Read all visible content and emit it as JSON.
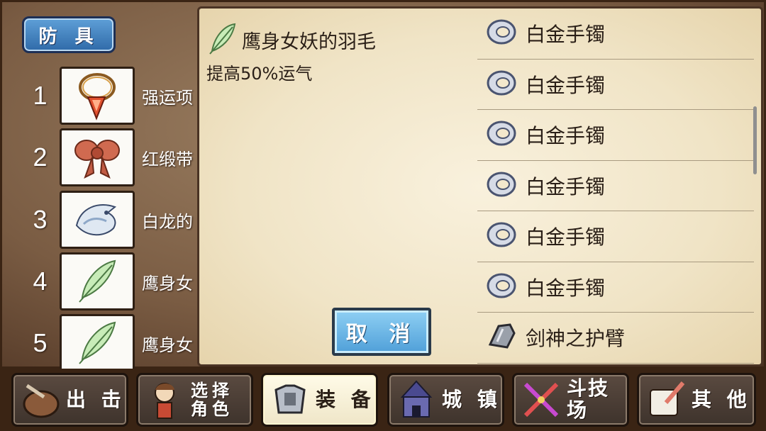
{
  "armor_category": "防 具",
  "armor_slots": [
    {
      "num": "1",
      "name": "强运项",
      "icon": "necklace-icon"
    },
    {
      "num": "2",
      "name": "红缎带",
      "icon": "ribbon-icon"
    },
    {
      "num": "3",
      "name": "白龙的",
      "icon": "white-dragon-icon"
    },
    {
      "num": "4",
      "name": "鹰身女",
      "icon": "feather-icon"
    },
    {
      "num": "5",
      "name": "鹰身女",
      "icon": "feather-icon"
    }
  ],
  "detail": {
    "name": "鹰身女妖的羽毛",
    "description": "提高50%运气",
    "icon": "feather-icon"
  },
  "cancel_label": "取 消",
  "item_list": [
    {
      "name": "白金手镯",
      "icon": "bracelet-icon"
    },
    {
      "name": "白金手镯",
      "icon": "bracelet-icon"
    },
    {
      "name": "白金手镯",
      "icon": "bracelet-icon"
    },
    {
      "name": "白金手镯",
      "icon": "bracelet-icon"
    },
    {
      "name": "白金手镯",
      "icon": "bracelet-icon"
    },
    {
      "name": "白金手镯",
      "icon": "bracelet-icon"
    },
    {
      "name": "剑神之护臂",
      "icon": "gauntlet-icon"
    }
  ],
  "nav": {
    "sortie": "出 击",
    "select_line1": "选择",
    "select_line2": "角色",
    "equip": "装 备",
    "town": "城 镇",
    "arena": "斗技场",
    "other": "其 他"
  },
  "colors": {
    "category_tab": "#3f7fc0",
    "cancel_button": "#6bb7e6",
    "parchment": "#f3e8cc",
    "frame": "#3a2414"
  }
}
